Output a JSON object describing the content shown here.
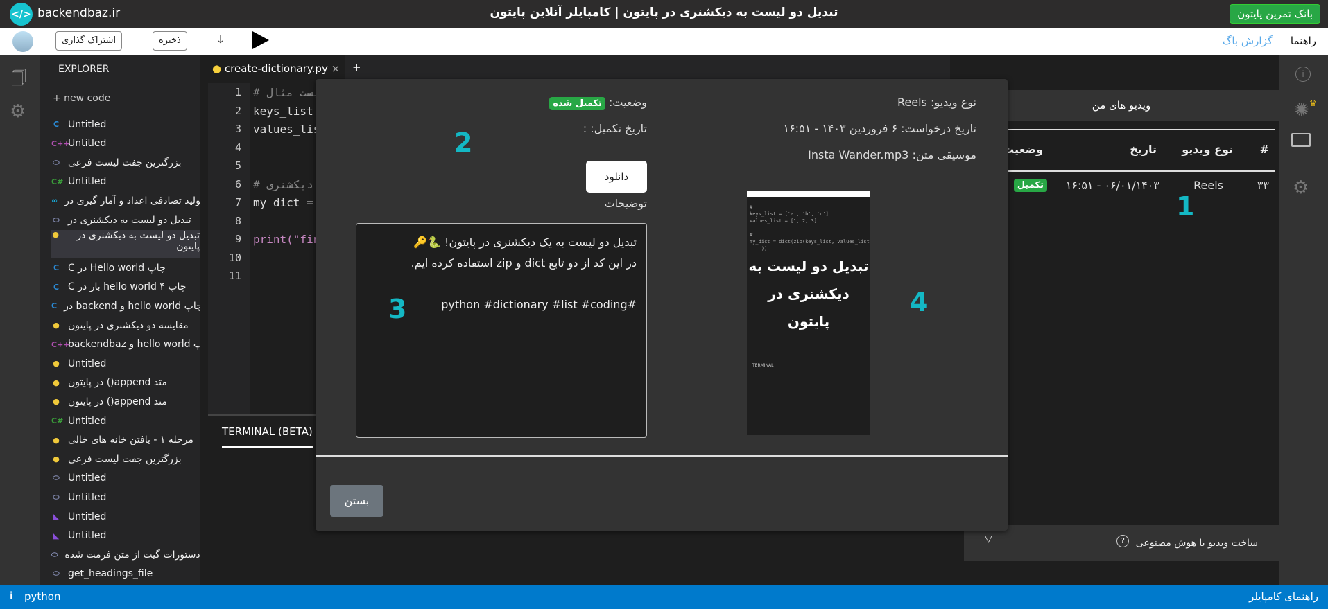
{
  "header": {
    "site": "backendbaz.ir",
    "title": "تبدیل دو لیست به دیکشنری در پایتون | کامپایلر آنلاین پایتون",
    "bank_button": "بانک تمرین پایتون"
  },
  "toolbar": {
    "share": "اشتراک گذاری",
    "save": "ذخیره",
    "help": "راهنما",
    "bug_report": "گزارش باگ"
  },
  "explorer": {
    "title": "EXPLORER",
    "new_code": "+ new code",
    "items": [
      {
        "label": "Untitled",
        "lang": "c"
      },
      {
        "label": "Untitled",
        "lang": "cpp"
      },
      {
        "label": "بزرگترین جفت لیست فرعی",
        "lang": "other"
      },
      {
        "label": "Untitled",
        "lang": "csharp"
      },
      {
        "label": "تولید تصادفی اعداد و آمار گیری در",
        "lang": "go"
      },
      {
        "label": "تبدیل دو لیست به دیکشنری در",
        "lang": "other"
      },
      {
        "label": "تبدیل دو لیست به دیکشنری در پایتون",
        "lang": "python"
      },
      {
        "label": "چاپ Hello world در C",
        "lang": "c"
      },
      {
        "label": "چاپ hello world ۴ بار در C",
        "lang": "c"
      },
      {
        "label": "چاپ hello world و backend در",
        "lang": "c"
      },
      {
        "label": "مقایسه دو دیکشنری در پایتون",
        "lang": "python"
      },
      {
        "label": "چاپ hello world و backendbaz",
        "lang": "cpp"
      },
      {
        "label": "Untitled",
        "lang": "python"
      },
      {
        "label": "متد append() در پایتون",
        "lang": "python"
      },
      {
        "label": "متد append() در پایتون",
        "lang": "python"
      },
      {
        "label": "Untitled",
        "lang": "csharp"
      },
      {
        "label": "مرحله ۱ - یافتن خانه های خالی",
        "lang": "python"
      },
      {
        "label": "بزرگترین جفت لیست فرعی",
        "lang": "python"
      },
      {
        "label": "Untitled",
        "lang": "other"
      },
      {
        "label": "Untitled",
        "lang": "other"
      },
      {
        "label": "Untitled",
        "lang": "kotlin"
      },
      {
        "label": "Untitled",
        "lang": "kotlin"
      },
      {
        "label": "دستورات گیت از متن فرمت شده",
        "lang": "other"
      },
      {
        "label": "get_headings_file",
        "lang": "other"
      }
    ]
  },
  "editor": {
    "tab": "create-dictionary.py",
    "lines": [
      "# لیست مثال",
      "keys_list",
      "values_lis",
      "",
      "",
      "# به دیکشنری",
      "my_dict =",
      "",
      "print(\"fin",
      "",
      ""
    ]
  },
  "terminal": {
    "tab": "TERMINAL (BETA)"
  },
  "right_panel": {
    "title": "ویدیو های من",
    "columns": [
      "#",
      "نوع ویدیو",
      "تاریخ",
      "وضعیت"
    ],
    "rows": [
      {
        "num": "۳۳",
        "type": "Reels",
        "date": "۱۶:۵۱ - ۰۶/۰۱/۱۴۰۳",
        "status": "تکمیل"
      }
    ],
    "ai_section": "ساخت ویدیو با هوش مصنوعی"
  },
  "modal": {
    "video_type": "نوع ویدیو: Reels",
    "request_date": "تاریخ درخواست: ۶ فروردین ۱۴۰۳ - ۱۶:۵۱",
    "music": "موسیقی متن: Insta Wander.mp3",
    "status_label": "وضعیت:",
    "status_value": "تکمیل شده",
    "completion_date": "تاریخ تکمیل: :",
    "download": "دانلود",
    "description_label": "توضیحات",
    "description": "تبدیل دو لیست به یک دیکشنری در پایتون! 🐍🔑\nدر این کد از دو تابع dict و zip استفاده کرده ایم.\n\n#python #dictionary #list #coding",
    "thumbnail_title": "تبدیل دو لیست به دیکشنری در پایتون",
    "close": "بستن",
    "annotations": [
      "1",
      "2",
      "3",
      "4"
    ]
  },
  "status_bar": {
    "language": "python",
    "guide": "راهنمای کامپایلر"
  },
  "colors": {
    "accent": "#007acc",
    "success": "#28a745",
    "annotation": "#14b8c4",
    "logo": "#17c3cf"
  }
}
